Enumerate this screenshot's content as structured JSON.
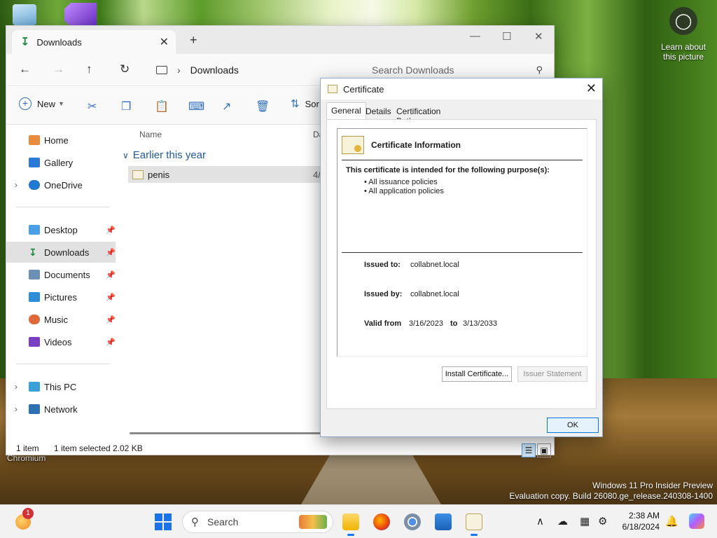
{
  "desktop": {
    "learn_text": "Learn about this picture",
    "chromium_label": "Chromium",
    "watermark_line1": "Windows 11 Pro Insider Preview",
    "watermark_line2": "Evaluation copy. Build 26080.ge_release.240308-1400"
  },
  "explorer": {
    "tab_title": "Downloads",
    "address_location": "Downloads",
    "search_placeholder": "Search Downloads",
    "new_label": "New",
    "sort_label": "Sor",
    "sidebar": {
      "home": "Home",
      "gallery": "Gallery",
      "onedrive": "OneDrive",
      "desktop": "Desktop",
      "downloads": "Downloads",
      "documents": "Documents",
      "pictures": "Pictures",
      "music": "Music",
      "videos": "Videos",
      "thispc": "This PC",
      "network": "Network"
    },
    "columns": {
      "name": "Name",
      "date": "Da"
    },
    "group_label": "Earlier this year",
    "file": {
      "name": "penis",
      "date": "4/"
    },
    "status": {
      "count": "1 item",
      "selected": "1 item selected",
      "size": "2.02 KB"
    }
  },
  "certificate": {
    "title": "Certificate",
    "tabs": [
      "General",
      "Details",
      "Certification Path"
    ],
    "info_title": "Certificate Information",
    "purpose_heading": "This certificate is intended for the following purpose(s):",
    "purposes": [
      "• All issuance policies",
      "• All application policies"
    ],
    "issued_to_label": "Issued to:",
    "issued_to": "collabnet.local",
    "issued_by_label": "Issued by:",
    "issued_by": "collabnet.local",
    "valid_from_label": "Valid from",
    "valid_from": "3/16/2023",
    "to_label": "to",
    "valid_to": "3/13/2033",
    "install_button": "Install Certificate...",
    "issuer_button": "Issuer Statement",
    "ok_button": "OK"
  },
  "taskbar": {
    "weather_badge": "1",
    "search_label": "Search",
    "time": "2:38 AM",
    "date": "6/18/2024"
  },
  "colors": {
    "accent": "#1a73e8",
    "folder_link": "#1e5a9c"
  }
}
